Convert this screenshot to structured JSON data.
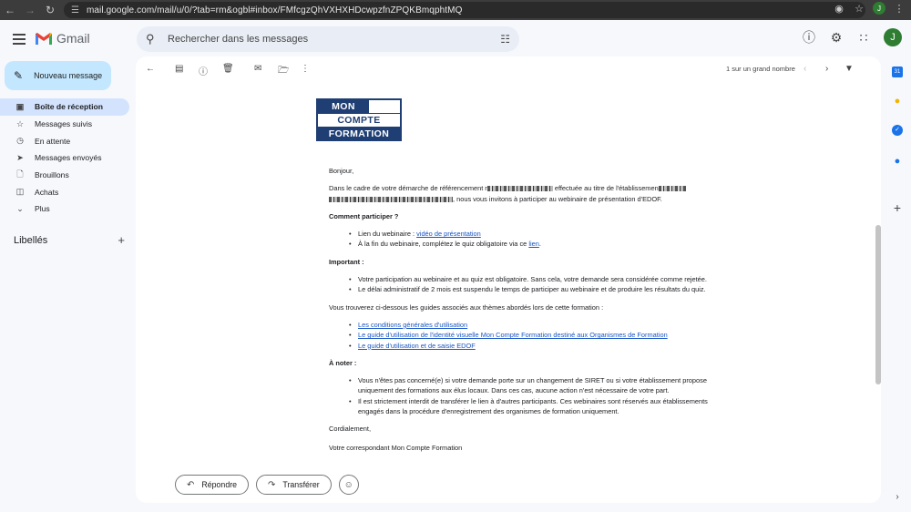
{
  "browser": {
    "url": "mail.google.com/mail/u/0/?tab=rm&ogbl#inbox/FMfcgzQhVXHXHDcwpzfnZPQKBmqphtMQ",
    "profile_initial": "J"
  },
  "app": {
    "name": "Gmail",
    "search_placeholder": "Rechercher dans les messages",
    "avatar_initial": "J"
  },
  "sidebar": {
    "compose_label": "Nouveau message",
    "items": [
      {
        "label": "Boîte de réception",
        "icon": "inbox-icon",
        "active": true
      },
      {
        "label": "Messages suivis",
        "icon": "star-icon"
      },
      {
        "label": "En attente",
        "icon": "clock-icon"
      },
      {
        "label": "Messages envoyés",
        "icon": "send-icon"
      },
      {
        "label": "Brouillons",
        "icon": "draft-icon"
      },
      {
        "label": "Achats",
        "icon": "tag-icon"
      },
      {
        "label": "Plus",
        "icon": "chevron-down-icon"
      }
    ],
    "labels_header": "Libellés"
  },
  "toolbar": {
    "pager": "1 sur un grand nombre"
  },
  "message": {
    "brand": {
      "line1": "MON",
      "line2": "COMPTE",
      "line3": "FORMATION"
    },
    "greeting": "Bonjour,",
    "intro_1": "Dans le cadre de votre démarche de référencement r",
    "intro_2": " effectuée au titre de l'établissemen",
    "intro_3": ", nous vous invitons à participer au webinaire de présentation d'EDOF.",
    "section_participer": "Comment participer ?",
    "participer_item1_prefix": "Lien du webinaire : ",
    "participer_item1_link": "vidéo de présentation",
    "participer_item2_prefix": "À la fin du webinaire, complétez le quiz obligatoire via ce ",
    "participer_item2_link": "lien",
    "participer_item2_suffix": ".",
    "section_important": "Important :",
    "important_item1": "Votre participation au webinaire et au quiz est obligatoire. Sans cela, votre demande sera considérée comme rejetée.",
    "important_item2": "Le délai administratif de 2 mois est suspendu le temps de participer au webinaire et de produire les résultats du quiz.",
    "guides_intro": "Vous trouverez ci-dessous les guides associés aux thèmes abordés lors de cette formation :",
    "guides": [
      "Les conditions générales d'utilisation",
      "Le guide d'utilisation de l'identité visuelle Mon Compte Formation destiné aux Organismes de Formation",
      "Le guide d'utilisation et de saisie EDOF"
    ],
    "section_noter": "À noter :",
    "noter_item1": "Vous n'êtes pas concerné(e) si votre demande porte sur un changement de SIRET ou si votre établissement propose uniquement des formations aux élus locaux. Dans ces cas, aucune action n'est nécessaire de votre part.",
    "noter_item2": "Il est strictement interdit de transférer le lien à d'autres participants. Ces webinaires sont réservés aux établissements engagés dans la procédure d'enregistrement des organismes de formation uniquement.",
    "closing": "Cordialement,",
    "signature": "Votre correspondant Mon Compte Formation"
  },
  "actions": {
    "reply": "Répondre",
    "forward": "Transférer"
  },
  "side_panel": {
    "calendar_day": "31"
  },
  "colors": {
    "compose_bg": "#c2e7ff",
    "nav_active_bg": "#d3e3fd",
    "brand_blue": "#1f3e73",
    "link": "#1a56c4"
  }
}
